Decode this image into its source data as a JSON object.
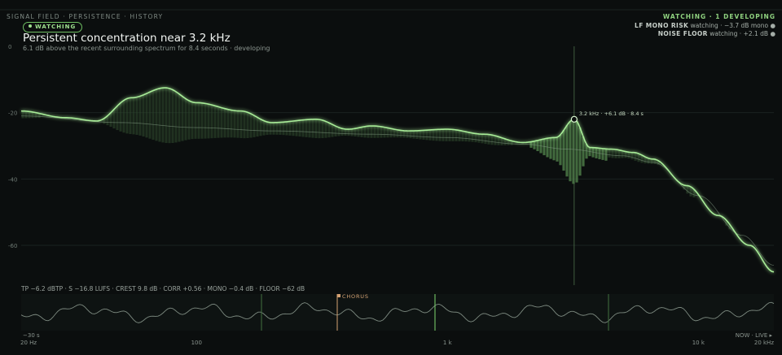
{
  "header": {
    "breadcrumb": "SIGNAL FIELD · PERSISTENCE · HISTORY",
    "badge": "WATCHING",
    "title": "Persistent concentration near 3.2 kHz",
    "subtitle": "6.1 dB above the recent surrounding spectrum for 8.4 seconds · developing"
  },
  "status": {
    "headline": "WATCHING · 1 DEVELOPING",
    "rows": [
      {
        "label": "LF MONO RISK",
        "value": "watching · −3.7 dB mono ●"
      },
      {
        "label": "NOISE FLOOR",
        "value": "watching · +2.1 dB ●"
      }
    ]
  },
  "colors": {
    "accent": "#9fe08f",
    "marker": "#d4a173",
    "background": "#0b0e0e"
  },
  "chart_data": {
    "type": "line",
    "x_scale": "log",
    "y_ticks": [
      0,
      -20,
      -40,
      -60
    ],
    "ylim": [
      -72,
      0
    ],
    "series": [
      {
        "points": [
          [
            20,
            -19.5
          ],
          [
            30,
            -21.5
          ],
          [
            40,
            -22.5
          ],
          [
            55,
            -15.5
          ],
          [
            75,
            -12.5
          ],
          [
            100,
            -17
          ],
          [
            150,
            -19.5
          ],
          [
            200,
            -23
          ],
          [
            300,
            -22
          ],
          [
            400,
            -25
          ],
          [
            500,
            -24
          ],
          [
            700,
            -25.5
          ],
          [
            1000,
            -25
          ],
          [
            1400,
            -26.5
          ],
          [
            2000,
            -29
          ],
          [
            2700,
            -27.5
          ],
          [
            3200,
            -22
          ],
          [
            3700,
            -30.5
          ],
          [
            4500,
            -31
          ],
          [
            5500,
            -32
          ],
          [
            6600,
            -34
          ],
          [
            9000,
            -42
          ],
          [
            12000,
            -51
          ],
          [
            16000,
            -60
          ],
          [
            20000,
            -68
          ]
        ]
      },
      {
        "points": [
          [
            20,
            -21
          ],
          [
            50,
            -23
          ],
          [
            100,
            -24.5
          ],
          [
            200,
            -25.5
          ],
          [
            500,
            -26.5
          ],
          [
            1000,
            -27.5
          ],
          [
            2000,
            -29.5
          ],
          [
            3000,
            -31
          ],
          [
            5000,
            -33
          ],
          [
            6600,
            -35
          ],
          [
            10000,
            -45
          ],
          [
            15000,
            -57
          ],
          [
            20000,
            -66
          ]
        ]
      }
    ],
    "annotation": {
      "freq": 3200,
      "db": -22,
      "text": "3.2 kHz · +6.1 dB · 8.4 s"
    }
  },
  "metrics": "TP −6.2 dBTP · S −16.8 LUFS · CREST 9.8 dB · CORR +0.56 · MONO −0.4 dB · FLOOR −62 dB",
  "history": {
    "marker_label": "CHORUS",
    "start_label": "−30 s",
    "end_label": "NOW · LIVE ▸"
  },
  "freq_ticks": [
    {
      "freq": 20,
      "label": "20 Hz"
    },
    {
      "freq": 100,
      "label": "100"
    },
    {
      "freq": 1000,
      "label": "1 k"
    },
    {
      "freq": 10000,
      "label": "10 k"
    },
    {
      "freq": 20000,
      "label": "20 kHz"
    }
  ]
}
